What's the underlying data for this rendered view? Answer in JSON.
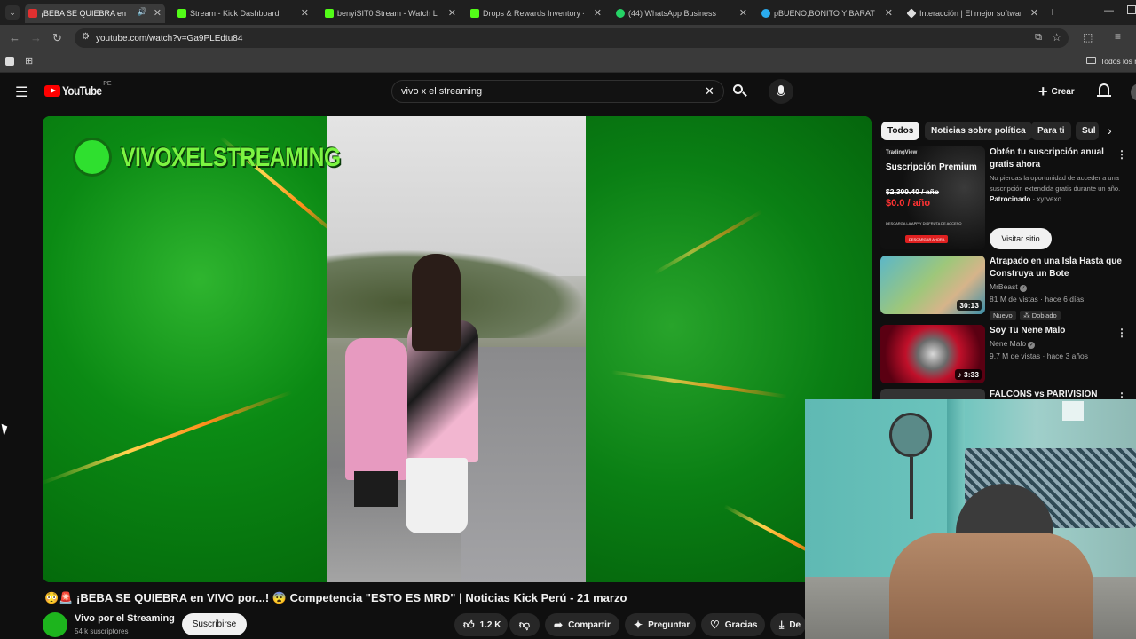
{
  "browser": {
    "tabs": [
      {
        "label": "¡BEBA SE QUIEBRA en",
        "color": "#e03030"
      },
      {
        "label": "Stream - Kick Dashboard",
        "color": "#53fc18"
      },
      {
        "label": "benyiSIT0 Stream - Watch Live",
        "color": "#53fc18"
      },
      {
        "label": "Drops & Rewards Inventory - K",
        "color": "#53fc18"
      },
      {
        "label": "(44) WhatsApp Business",
        "color": "#25d366"
      },
      {
        "label": "pBUENO,BONITO Y BARATO",
        "color": "#2aabee"
      },
      {
        "label": "Interacción | El mejor software",
        "color": "#dddddd"
      }
    ],
    "url": "youtube.com/watch?v=Ga9PLEdtu84",
    "bookmarks_label": "Todos los m"
  },
  "youtube": {
    "logo_text": "YouTube",
    "region": "PE",
    "search_value": "vivo x el streaming",
    "create_label": "Crear"
  },
  "video": {
    "overlay_brand": "VIVOXELSTREAMING",
    "title": "😳🚨 ¡BEBA SE QUIEBRA en VIVO por...! 😨 Competencia \"ESTO ES MRD\" | Noticias Kick Perú - 21 marzo"
  },
  "channel": {
    "name": "Vivo por el Streaming",
    "subscribers": "54 k suscriptores",
    "subscribe_label": "Suscribirse"
  },
  "actions": {
    "likes": "1.2 K",
    "share": "Compartir",
    "ask": "Preguntar",
    "thanks": "Gracias",
    "download": "De"
  },
  "chips": [
    "Todos",
    "Noticias sobre política",
    "Para ti",
    "Sul"
  ],
  "ad": {
    "title": "Obtén tu suscripción anual gratis ahora",
    "description": "No pierdas la oportunidad de acceder a una suscripción extendida gratis durante un año.",
    "sponsored": "Patrocinado",
    "advertiser": "xyrvexo",
    "cta": "Visitar sitio",
    "thumb_brand": "TradingView",
    "thumb_headline": "Suscripción Premium",
    "thumb_old_price": "$2,399.40 / año",
    "thumb_new_price": "$0.0 / año",
    "thumb_tagline": "DESCARGA LA APP Y DISFRUTA DE ACCESO",
    "thumb_button": "DESCARGAR AHORA"
  },
  "recommendations": [
    {
      "title": "Atrapado en una Isla Hasta que Construya un Bote",
      "channel": "MrBeast",
      "stats": "81 M de vistas · hace 6 días",
      "duration": "30:13",
      "badge_new": "Nuevo",
      "badge_dub": "Doblado"
    },
    {
      "title": "Soy Tu Nene Malo",
      "channel": "Nene Malo",
      "stats": "9.7 M de vistas · hace 3 años",
      "duration": "3:33"
    },
    {
      "title": "FALCONS vs PARIVISION"
    }
  ]
}
